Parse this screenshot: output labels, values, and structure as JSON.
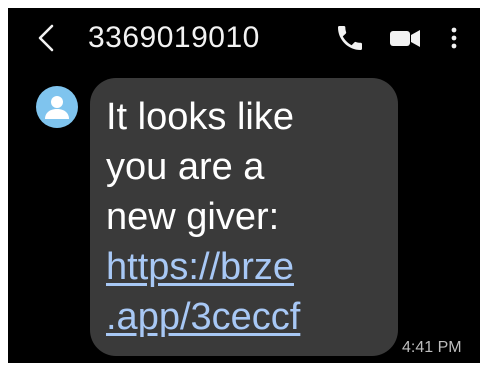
{
  "header": {
    "contact_number": "3369019010",
    "icons": {
      "back": "chevron-left-icon",
      "call": "phone-icon",
      "video": "video-camera-icon",
      "more": "more-vertical-icon"
    }
  },
  "message": {
    "text": "It looks like\nyou are a\nnew giver:",
    "link": "https://brze\n.app/3ceccf",
    "time": "4:41 PM"
  },
  "colors": {
    "background": "#000000",
    "bubble": "#3a3a3a",
    "avatar": "#7fc4ee",
    "link": "#a8c8f5"
  }
}
